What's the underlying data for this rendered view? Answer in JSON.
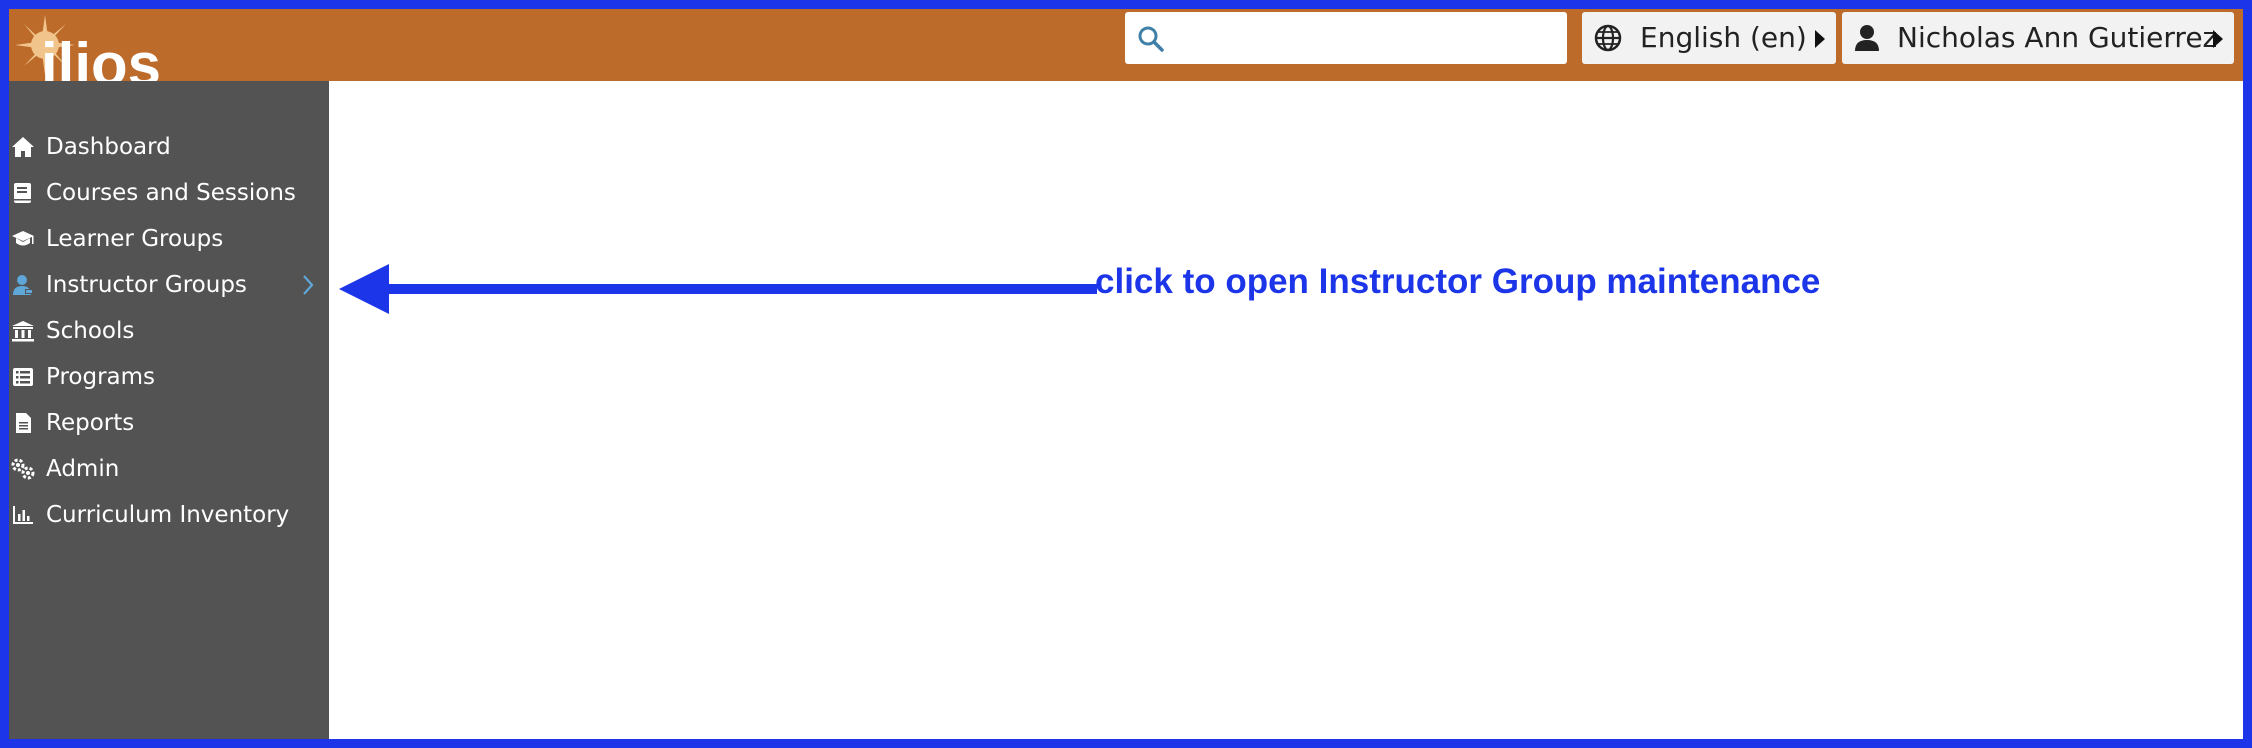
{
  "app": {
    "logo_text": "ilios"
  },
  "header": {
    "search": {
      "placeholder": "",
      "value": ""
    },
    "language_label": "English (en)",
    "user_name": "Nicholas Ann Gutierrez"
  },
  "sidebar": {
    "items": [
      {
        "label": "Dashboard",
        "icon": "home-icon"
      },
      {
        "label": "Courses and Sessions",
        "icon": "book-icon"
      },
      {
        "label": "Learner Groups",
        "icon": "graduation-cap-icon"
      },
      {
        "label": "Instructor Groups",
        "icon": "chalkboard-user-icon"
      },
      {
        "label": "Schools",
        "icon": "university-icon"
      },
      {
        "label": "Programs",
        "icon": "list-icon"
      },
      {
        "label": "Reports",
        "icon": "file-icon"
      },
      {
        "label": "Admin",
        "icon": "cogs-icon"
      },
      {
        "label": "Curriculum Inventory",
        "icon": "chart-bar-icon"
      }
    ]
  },
  "annotation": {
    "text": "click to open Instructor Group maintenance"
  },
  "colors": {
    "header_bg": "#bd6b2b",
    "sidebar_bg": "#535353",
    "annotation_blue": "#1c35e8",
    "accent_link": "#5fa7d8"
  }
}
